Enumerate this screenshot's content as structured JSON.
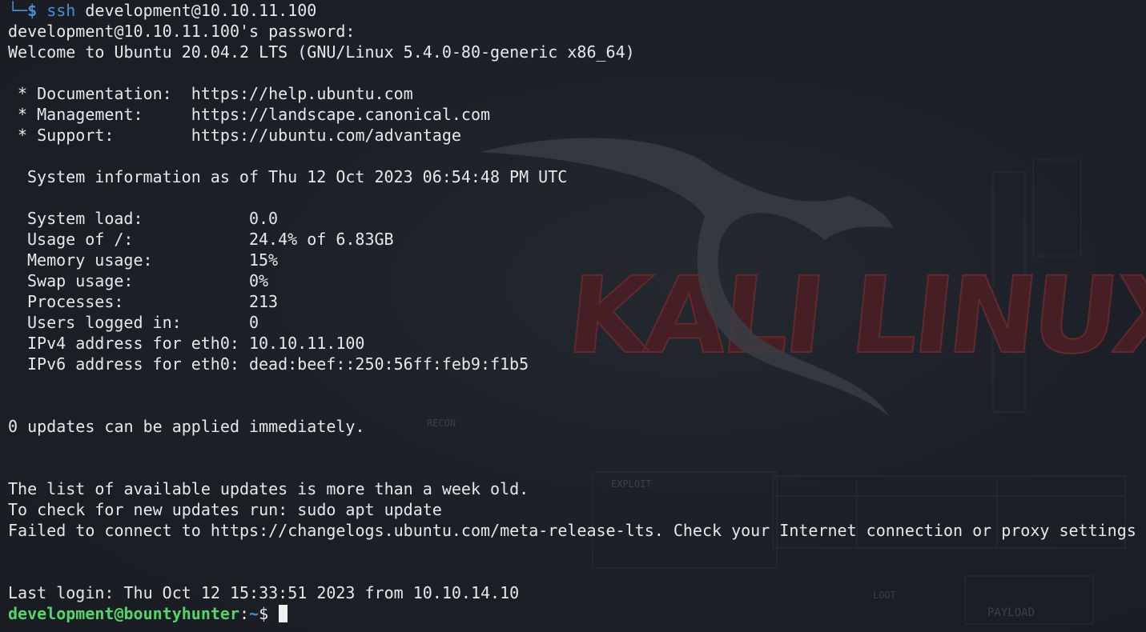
{
  "terminal": {
    "first_prompt": {
      "corner": "└─",
      "symbol": "$",
      "command": "ssh",
      "args": "development@10.10.11.100"
    },
    "password_prompt": "development@10.10.11.100's password:",
    "welcome": "Welcome to Ubuntu 20.04.2 LTS (GNU/Linux 5.4.0-80-generic x86_64)",
    "links": [
      {
        "label": " * Documentation:  ",
        "url": "https://help.ubuntu.com"
      },
      {
        "label": " * Management:     ",
        "url": "https://landscape.canonical.com"
      },
      {
        "label": " * Support:        ",
        "url": "https://ubuntu.com/advantage"
      }
    ],
    "sysinfo_header": "System information as of Thu 12 Oct 2023 06:54:48 PM UTC",
    "sysinfo": [
      {
        "key": "System load:           ",
        "value": "0.0"
      },
      {
        "key": "Usage of /:            ",
        "value": "24.4% of 6.83GB"
      },
      {
        "key": "Memory usage:          ",
        "value": "15%"
      },
      {
        "key": "Swap usage:            ",
        "value": "0%"
      },
      {
        "key": "Processes:             ",
        "value": "213"
      },
      {
        "key": "Users logged in:       ",
        "value": "0"
      },
      {
        "key": "IPv4 address for eth0: ",
        "value": "10.10.11.100"
      },
      {
        "key": "IPv6 address for eth0: ",
        "value": "dead:beef::250:56ff:feb9:f1b5"
      }
    ],
    "updates_msg": "0 updates can be applied immediately.",
    "update_lines": [
      "The list of available updates is more than a week old.",
      "To check for new updates run: sudo apt update",
      "Failed to connect to https://changelogs.ubuntu.com/meta-release-lts. Check your Internet connection or proxy settings"
    ],
    "last_login": "Last login: Thu Oct 12 15:33:51 2023 from 10.10.14.10",
    "final_prompt": {
      "user_host": "development@bountyhunter",
      "separator": ":",
      "path": "~",
      "symbol": "$ "
    }
  },
  "wallpaper": {
    "logo_text": "KALI LINUX",
    "labels": [
      "RECON",
      "EXPLOIT",
      "LOOT",
      "PAYLOAD"
    ]
  },
  "colors": {
    "background": "#1b1f27",
    "text": "#e8e8e8",
    "prompt_blue": "#4b8fd9",
    "user_green": "#55d46a",
    "logo_red": "#5a2327"
  }
}
